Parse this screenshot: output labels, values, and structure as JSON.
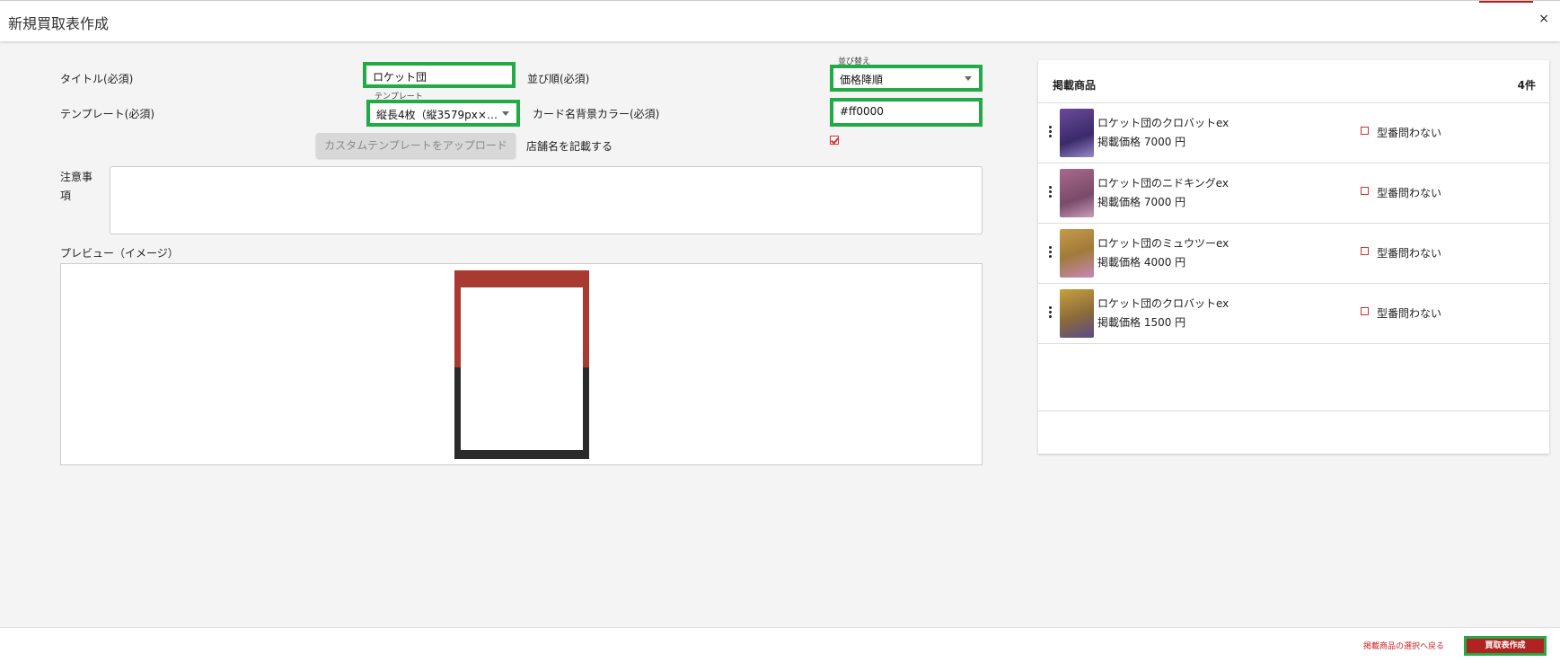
{
  "header": {
    "title": "新規買取表作成",
    "close": "×"
  },
  "form": {
    "title_label": "タイトル(必須)",
    "title_value": "ロケット団",
    "sort_label": "並び順(必須)",
    "sort_caption": "並び替え",
    "sort_value": "価格降順",
    "template_label": "テンプレート(必須)",
    "template_caption": "テンプレート",
    "template_value": "縦長4枚（縦3579px×…",
    "bgcolor_label": "カード名背景カラー(必須)",
    "bgcolor_value": "#ff0000",
    "upload_button": "カスタムテンプレートをアップロード",
    "store_name_label": "店舗名を記載する",
    "notes_label_line1": "注意事",
    "notes_label_line2": "項",
    "preview_label": "プレビュー（イメージ）"
  },
  "panel": {
    "title": "掲載商品",
    "count": "4件",
    "items": [
      {
        "name": "ロケット団のクロバットex",
        "price": "掲載価格 7000 円",
        "option": "型番問わない",
        "thumb_color": "#6b4a9a"
      },
      {
        "name": "ロケット団のニドキングex",
        "price": "掲載価格 7000 円",
        "option": "型番問わない",
        "thumb_color": "#a86a8a"
      },
      {
        "name": "ロケット団のミュウツーex",
        "price": "掲載価格 4000 円",
        "option": "型番問わない",
        "thumb_color": "#c89a4a"
      },
      {
        "name": "ロケット団のクロバットex",
        "price": "掲載価格 1500 円",
        "option": "型番問わない",
        "thumb_color": "#8a6a3a"
      }
    ]
  },
  "footer": {
    "back_link": "掲載商品の選択へ戻る",
    "create_button": "買取表作成"
  },
  "colors": {
    "accent_red": "#b22222",
    "highlight_green": "#22aa44",
    "preview_top": "#a83a32",
    "preview_bottom": "#2b2b2b"
  }
}
